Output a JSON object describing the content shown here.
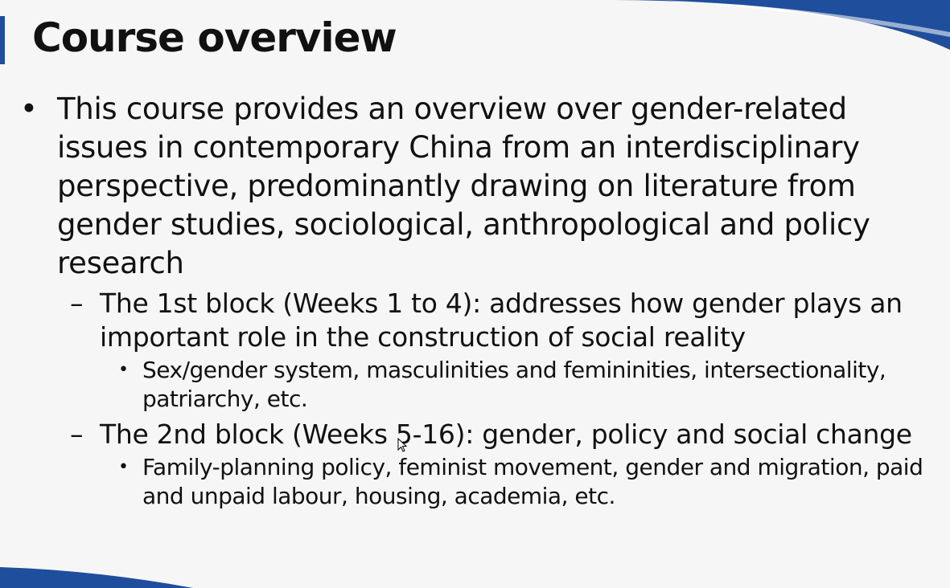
{
  "slide": {
    "title": "Course overview",
    "bullets": [
      {
        "text": "This course provides an overview over gender-related issues in contemporary China from an interdisciplinary perspective, predominantly drawing on literature from gender studies, sociological, anthropological and policy research",
        "sub": [
          {
            "text": "The 1st block (Weeks 1 to 4): addresses how gender plays an important role in the construction of social reality",
            "sub": [
              "Sex/gender system, masculinities and femininities, intersectionality, patriarchy, etc."
            ]
          },
          {
            "text": "The 2nd block (Weeks 5-16): gender, policy and social change",
            "sub": [
              "Family-planning policy, feminist movement, gender and migration, paid and unpaid labour, housing, academia, etc."
            ]
          }
        ]
      }
    ],
    "markers": {
      "level1": "•",
      "level2": "–",
      "level3": "•"
    }
  },
  "colors": {
    "accent": "#1f4e9c",
    "text": "#111111",
    "background": "#f6f6f6"
  }
}
